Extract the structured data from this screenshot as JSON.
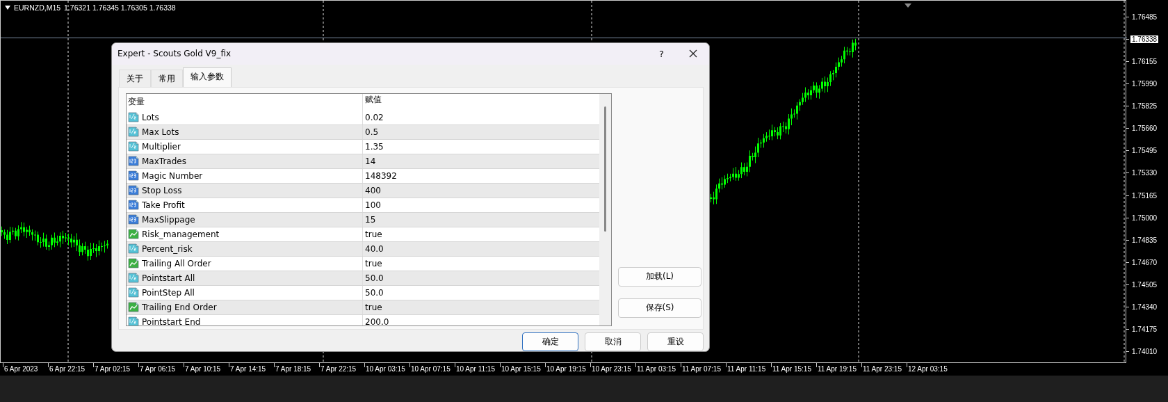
{
  "chart": {
    "symbol": "EURNZD,M15",
    "ohlc": "1.76321 1.76345 1.76305 1.76338",
    "price_labels": [
      {
        "text": "1.76485",
        "current": false
      },
      {
        "text": "1.76338",
        "current": true
      },
      {
        "text": "1.76155",
        "current": false
      },
      {
        "text": "1.75990",
        "current": false
      },
      {
        "text": "1.75825",
        "current": false
      },
      {
        "text": "1.75660",
        "current": false
      },
      {
        "text": "1.75495",
        "current": false
      },
      {
        "text": "1.75330",
        "current": false
      },
      {
        "text": "1.75165",
        "current": false
      },
      {
        "text": "1.75000",
        "current": false
      },
      {
        "text": "1.74835",
        "current": false
      },
      {
        "text": "1.74670",
        "current": false
      },
      {
        "text": "1.74505",
        "current": false
      },
      {
        "text": "1.74340",
        "current": false
      },
      {
        "text": "1.74175",
        "current": false
      },
      {
        "text": "1.74010",
        "current": false
      }
    ],
    "time_labels": [
      "6 Apr 2023",
      "6 Apr 22:15",
      "7 Apr 02:15",
      "7 Apr 06:15",
      "7 Apr 10:15",
      "7 Apr 14:15",
      "7 Apr 18:15",
      "7 Apr 22:15",
      "10 Apr 03:15",
      "10 Apr 07:15",
      "10 Apr 11:15",
      "10 Apr 15:15",
      "10 Apr 19:15",
      "10 Apr 23:15",
      "11 Apr 03:15",
      "11 Apr 07:15",
      "11 Apr 11:15",
      "11 Apr 15:15",
      "11 Apr 19:15",
      "11 Apr 23:15",
      "12 Apr 03:15"
    ]
  },
  "dialog": {
    "title": "Expert - Scouts Gold V9_fix",
    "help": "?",
    "tabs": [
      {
        "label": "关于",
        "selected": false
      },
      {
        "label": "常用",
        "selected": false
      },
      {
        "label": "输入参数",
        "selected": true
      }
    ],
    "columns": [
      "变量",
      "赋值"
    ],
    "rows": [
      {
        "kind": "double",
        "name": "Lots",
        "value": "0.02"
      },
      {
        "kind": "double",
        "name": "Max Lots",
        "value": "0.5"
      },
      {
        "kind": "double",
        "name": "Multiplier",
        "value": "1.35"
      },
      {
        "kind": "int",
        "name": "MaxTrades",
        "value": "14"
      },
      {
        "kind": "int",
        "name": "Magic Number",
        "value": "148392"
      },
      {
        "kind": "int",
        "name": "Stop Loss",
        "value": "400"
      },
      {
        "kind": "int",
        "name": "Take Profit",
        "value": "100"
      },
      {
        "kind": "int",
        "name": "MaxSlippage",
        "value": "15"
      },
      {
        "kind": "bool",
        "name": "Risk_management",
        "value": "true"
      },
      {
        "kind": "double",
        "name": "Percent_risk",
        "value": "40.0"
      },
      {
        "kind": "bool",
        "name": "Trailing All Order",
        "value": "true"
      },
      {
        "kind": "double",
        "name": "Pointstart All",
        "value": "50.0"
      },
      {
        "kind": "double",
        "name": "PointStep All",
        "value": "50.0"
      },
      {
        "kind": "bool",
        "name": "Trailing End Order",
        "value": "true"
      },
      {
        "kind": "double",
        "name": "Pointstart End",
        "value": "200.0"
      }
    ],
    "side_buttons": [
      "加载(L)",
      "保存(S)"
    ],
    "buttons": [
      {
        "label": "确定",
        "default": true
      },
      {
        "label": "取消",
        "default": false
      },
      {
        "label": "重设",
        "default": false
      }
    ]
  }
}
